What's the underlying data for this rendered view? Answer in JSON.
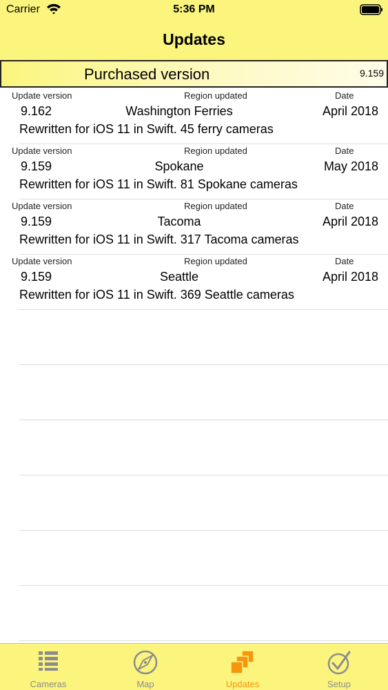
{
  "status_bar": {
    "carrier": "Carrier",
    "time": "5:36 PM"
  },
  "nav": {
    "title": "Updates"
  },
  "purchased": {
    "label": "Purchased version",
    "value": "9.159"
  },
  "updates": {
    "column_labels": {
      "version": "Update version",
      "region": "Region updated",
      "date": "Date"
    },
    "rows": [
      {
        "version": "9.162",
        "region": "Washington Ferries",
        "date": "April 2018",
        "description": "Rewritten for iOS 11 in Swift. 45 ferry cameras"
      },
      {
        "version": "9.159",
        "region": "Spokane",
        "date": "May 2018",
        "description": "Rewritten for iOS 11 in Swift. 81 Spokane cameras"
      },
      {
        "version": "9.159",
        "region": "Tacoma",
        "date": "April 2018",
        "description": "Rewritten for iOS 11 in Swift. 317 Tacoma cameras"
      },
      {
        "version": "9.159",
        "region": "Seattle",
        "date": "April 2018",
        "description": "Rewritten for iOS 11 in Swift. 369 Seattle cameras"
      }
    ]
  },
  "tabbar": {
    "tabs": [
      {
        "label": "Cameras",
        "icon": "list-icon",
        "active": false
      },
      {
        "label": "Map",
        "icon": "compass-icon",
        "active": false
      },
      {
        "label": "Updates",
        "icon": "stacked-squares-icon",
        "active": true
      },
      {
        "label": "Setup",
        "icon": "checkmark-circle-icon",
        "active": false
      }
    ]
  },
  "colors": {
    "bar_yellow": "#fbf57e",
    "active_tab": "#f6960e",
    "inactive_tab": "#8c8c8c"
  }
}
